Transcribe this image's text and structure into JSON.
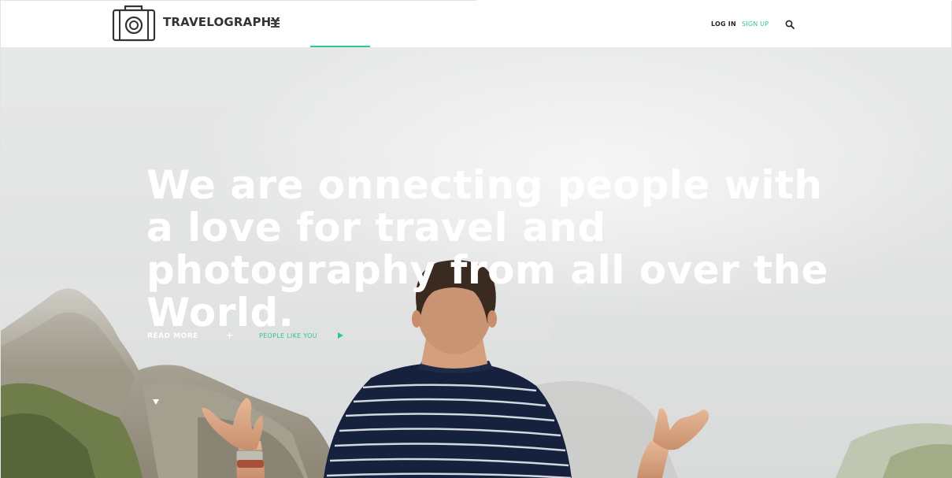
{
  "header": {
    "brand": "TRAVELOGRAPHY",
    "login_label": "LOG IN",
    "signup_label": "SIGN UP",
    "icons": [
      "camera-logo-icon",
      "menu-icon",
      "search-icon"
    ]
  },
  "hero": {
    "headline": "We are onnecting people with a love for travel and photography from all over the World.",
    "read_more_label": "READ MORE",
    "plus_symbol": "+",
    "people_label": "PEOPLE LIKE YOU",
    "icons": [
      "plus-icon",
      "play-icon",
      "scroll-down-icon"
    ]
  },
  "colors": {
    "accent": "#2ec4a0",
    "text_dark": "#333333",
    "header_bg": "#ffffff",
    "headline": "#ffffff"
  }
}
